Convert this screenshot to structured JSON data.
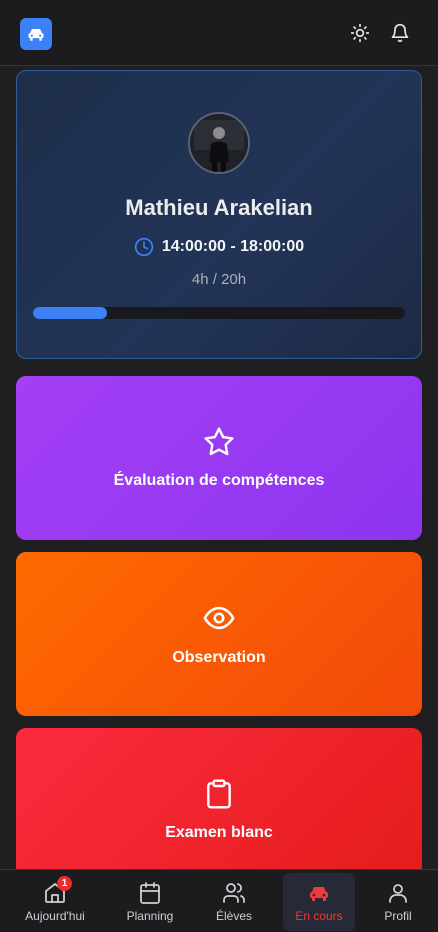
{
  "student": {
    "name": "Mathieu Arakelian",
    "time_range": "14:00:00 - 18:00:00",
    "hours_label": "4h / 20h",
    "progress_fraction": 0.2
  },
  "actions": [
    {
      "label": "Évaluation de compétences",
      "icon": "star-icon"
    },
    {
      "label": "Observation",
      "icon": "eye-icon"
    },
    {
      "label": "Examen blanc",
      "icon": "clipboard-icon"
    }
  ],
  "nav": {
    "items": [
      {
        "label": "Aujourd'hui",
        "icon": "home-icon",
        "badge": "1"
      },
      {
        "label": "Planning",
        "icon": "calendar-icon"
      },
      {
        "label": "Élèves",
        "icon": "users-icon"
      },
      {
        "label": "En cours",
        "icon": "car-icon",
        "active": true
      },
      {
        "label": "Profil",
        "icon": "user-icon"
      }
    ]
  },
  "colors": {
    "accent": "#3b82f6",
    "active_nav": "#ef3a3a",
    "eval": "#9b3df3",
    "observation": "#fb5a05",
    "exam": "#f02530"
  }
}
